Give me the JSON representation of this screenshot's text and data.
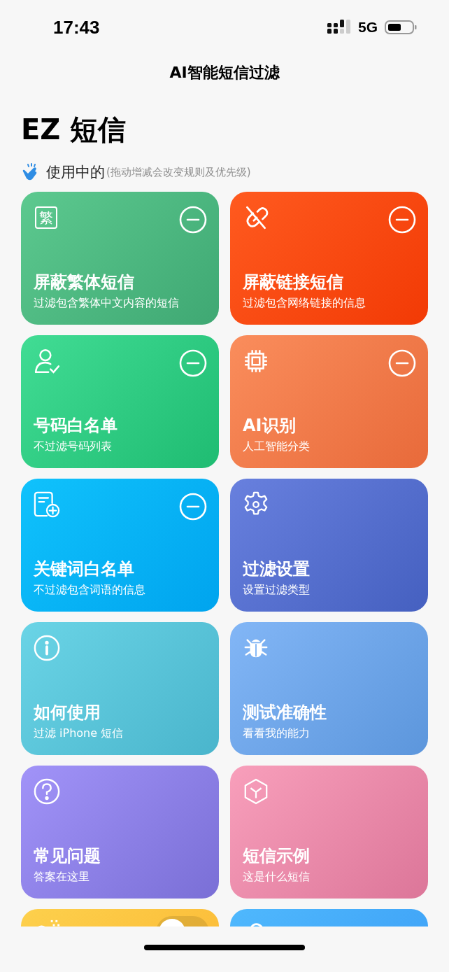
{
  "status_bar": {
    "time": "17:43",
    "network": "5G"
  },
  "nav": {
    "title": "AI智能短信过滤"
  },
  "app_title": "EZ 短信",
  "section": {
    "label": "使用中的",
    "hint": "(拖动增减会改变规则及优先级)"
  },
  "cards": [
    {
      "kind": "rule",
      "glyph": "繁",
      "title": "屏蔽繁体短信",
      "subtitle": "过滤包含繁体中文内容的短信",
      "removable": true
    },
    {
      "kind": "rule",
      "title": "屏蔽链接短信",
      "subtitle": "过滤包含网络链接的信息",
      "removable": true
    },
    {
      "kind": "rule",
      "title": "号码白名单",
      "subtitle": "不过滤号码列表",
      "removable": true
    },
    {
      "kind": "rule",
      "title": "AI识别",
      "subtitle": "人工智能分类",
      "removable": true
    },
    {
      "kind": "rule",
      "title": "关键词白名单",
      "subtitle": "不过滤包含词语的信息",
      "removable": true
    },
    {
      "kind": "rule",
      "title": "过滤设置",
      "subtitle": "设置过滤类型",
      "removable": false
    },
    {
      "kind": "rule",
      "title": "如何使用",
      "subtitle": "过滤 iPhone 短信",
      "removable": false
    },
    {
      "kind": "rule",
      "title": "测试准确性",
      "subtitle": "看看我的能力",
      "removable": false
    },
    {
      "kind": "rule",
      "title": "常见问题",
      "subtitle": "答案在这里",
      "removable": false
    },
    {
      "kind": "rule",
      "title": "短信示例",
      "subtitle": "这是什么短信",
      "removable": false
    },
    {
      "kind": "toggle",
      "on": false
    },
    {
      "kind": "plain"
    }
  ]
}
